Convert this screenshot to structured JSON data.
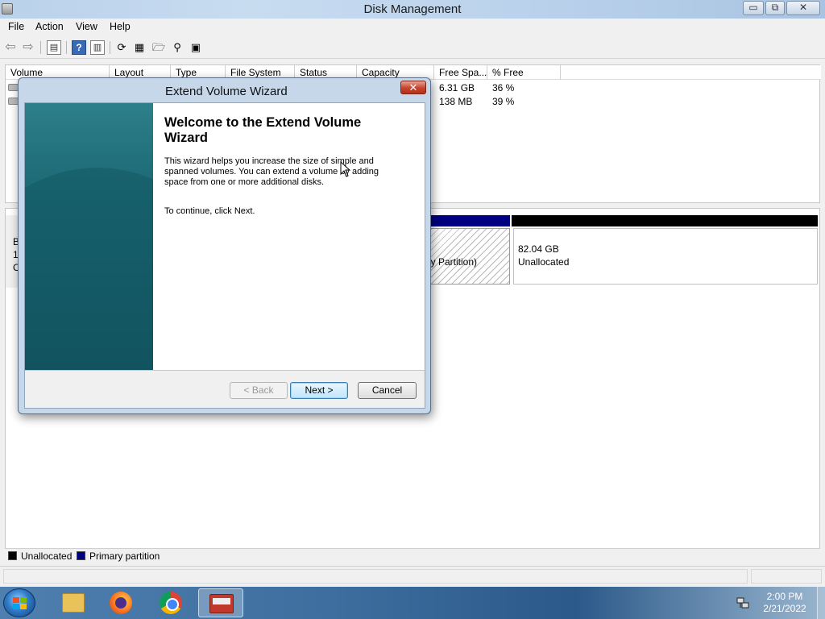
{
  "window": {
    "title": "Disk Management",
    "controls": {
      "minimize": "▭",
      "maximize": "⧉",
      "close": "✕"
    }
  },
  "menu": [
    "File",
    "Action",
    "View",
    "Help"
  ],
  "toolbar": {
    "icons": [
      "back-icon",
      "forward-icon",
      "show-hide-console-tree-icon",
      "help-icon",
      "properties-icon",
      "refresh-icon",
      "rescan-icon",
      "open-icon",
      "search-icon",
      "disk-icon"
    ]
  },
  "volume_list": {
    "columns": [
      "Volume",
      "Layout",
      "Type",
      "File System",
      "Status",
      "Capacity",
      "Free Spa...",
      "% Free"
    ],
    "rows": [
      {
        "free_space": "6.31 GB",
        "pct_free": "36 %"
      },
      {
        "free_space": "138 MB",
        "pct_free": "39 %"
      }
    ]
  },
  "disk_graph": {
    "disk_label_lines": [
      "B",
      "1(",
      "O"
    ],
    "partition_text": "mary Partition)",
    "unallocated": {
      "size": "82.04 GB",
      "label": "Unallocated"
    },
    "colors": {
      "primary": "#000080",
      "unallocated": "#000000"
    }
  },
  "legend": [
    {
      "label": "Unallocated",
      "color": "#000000"
    },
    {
      "label": "Primary partition",
      "color": "#000080"
    }
  ],
  "wizard": {
    "title": "Extend Volume Wizard",
    "heading": "Welcome to the Extend Volume Wizard",
    "description": "This wizard helps you increase the size of simple and spanned volumes. You can extend a volume  by adding space from one or more additional disks.",
    "continue_text": "To continue, click Next.",
    "buttons": {
      "back": "< Back",
      "next": "Next >",
      "cancel": "Cancel"
    },
    "close": "✕"
  },
  "taskbar": {
    "apps": [
      "windows-explorer",
      "firefox",
      "chrome",
      "disk-management"
    ],
    "clock": {
      "time": "2:00 PM",
      "date": "2/21/2022"
    }
  }
}
